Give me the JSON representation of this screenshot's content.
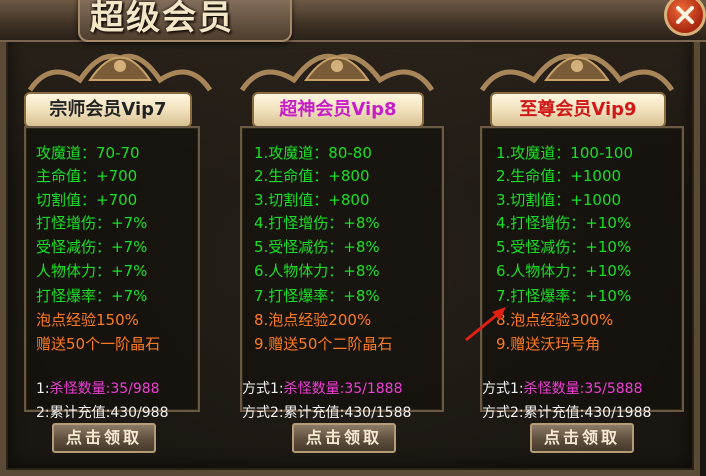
{
  "title": "超级会员",
  "close_icon": "close-icon",
  "colors": {
    "stat_green": "#18e024",
    "stat_orange": "#ff7a1f",
    "cond_magenta": "#f03ed8",
    "arrow_red": "#e02010"
  },
  "panels": [
    {
      "title": "宗师会员Vip7",
      "title_color": "#222222",
      "stats": [
        "攻魔道：70-70",
        "主命值：+700",
        "切割值：+700",
        "打怪增伤：+7%",
        "受怪减伤：+7%",
        "人物体力：+7%",
        "打怪爆率：+7%",
        "泡点经验150%",
        "赠送50个一阶晶石"
      ],
      "cond1_label": "1:",
      "cond1_value": "杀怪数量:35/988",
      "cond2_label": "2:",
      "cond2_value": "累计充值:430/988",
      "button": "点击领取"
    },
    {
      "title": "超神会员Vip8",
      "title_color": "#c81ec8",
      "stats": [
        "1.攻魔道：80-80",
        "2.生命值：+800",
        "3.切割值：+800",
        "4.打怪增伤：+8%",
        "5.受怪减伤：+8%",
        "6.人物体力：+8%",
        "7.打怪爆率：+8%",
        "8.泡点经验200%",
        "9.赠送50个二阶晶石"
      ],
      "cond1_label": "方式1:",
      "cond1_value": "杀怪数量:35/1888",
      "cond2_label": "方式2:",
      "cond2_value": "累计充值:430/1588",
      "button": "点击领取"
    },
    {
      "title": "至尊会员Vip9",
      "title_color": "#d01818",
      "stats": [
        "1.攻魔道：100-100",
        "2.生命值：+1000",
        "3.切割值：+1000",
        "4.打怪增伤：+10%",
        "5.受怪减伤：+10%",
        "6.人物体力：+10%",
        "7.打怪爆率：+10%",
        "8.泡点经验300%",
        "9.赠送沃玛号角"
      ],
      "cond1_label": "方式1:",
      "cond1_value": "杀怪数量:35/5888",
      "cond2_label": "方式2:",
      "cond2_value": "累计充值:430/1988",
      "button": "点击领取"
    }
  ]
}
